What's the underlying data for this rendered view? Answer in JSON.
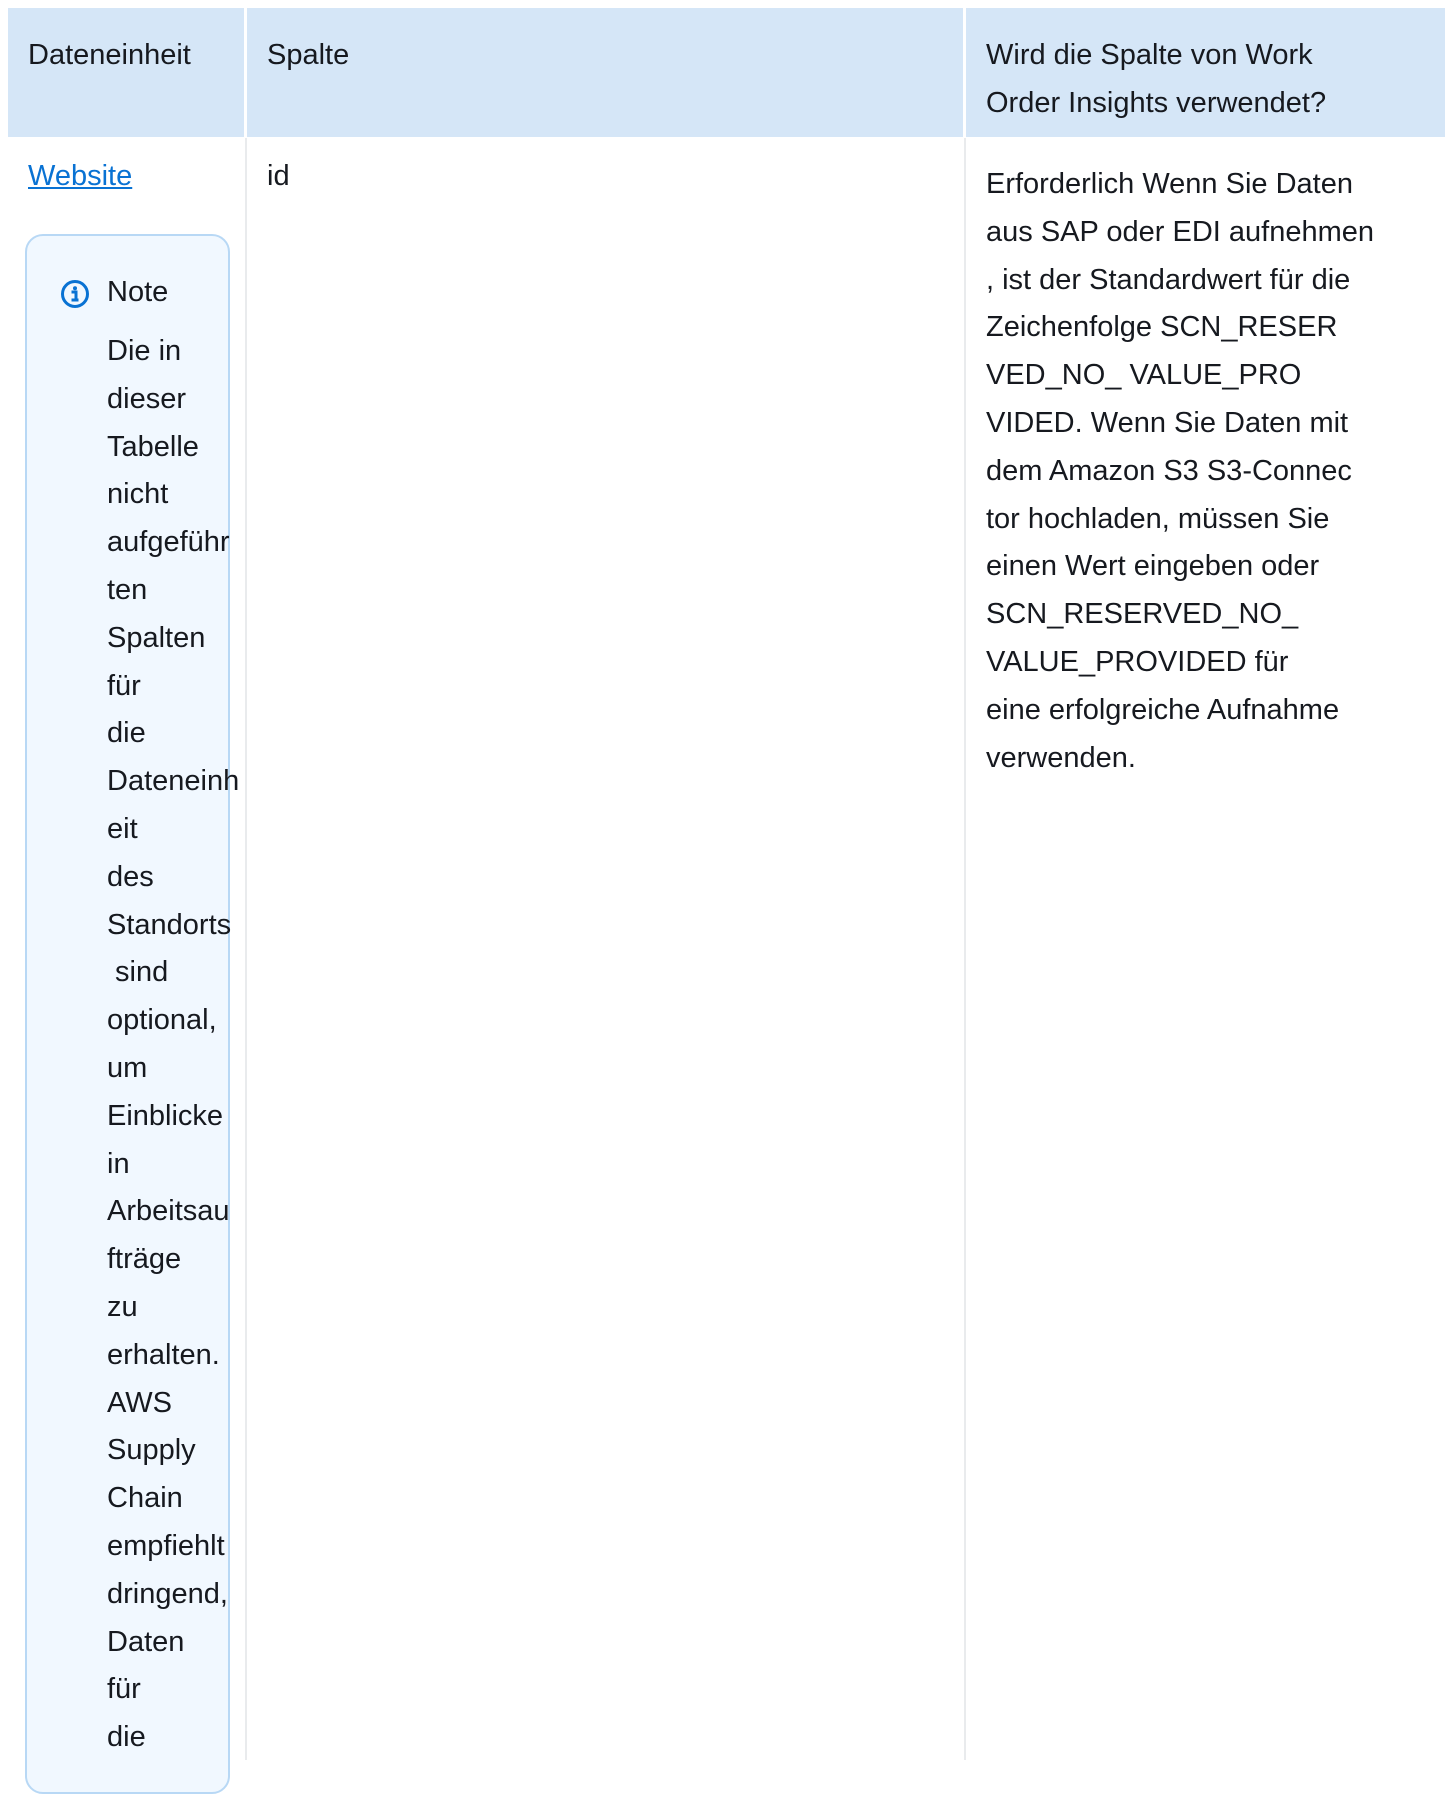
{
  "table": {
    "headers": {
      "entity": "Dateneinheit",
      "column": "Spalte",
      "used": "Wird die Spalte von Work\nOrder Insights verwendet?"
    },
    "row": {
      "entity_link": "Website",
      "note": {
        "title": "Note",
        "icon": "info-icon",
        "lines": [
          "Die in",
          "dieser",
          "Tabelle",
          "nicht",
          "aufgeführ",
          "ten",
          "Spalten",
          "für",
          "die",
          "Dateneinh",
          "eit",
          "des",
          "Standorts",
          " sind",
          "optional,",
          "um",
          "Einblicke",
          "in",
          "Arbeitsau",
          "fträge",
          "zu",
          "erhalten.",
          "AWS",
          "Supply",
          "Chain",
          "empfiehlt",
          "dringend,",
          "Daten",
          "für",
          "die"
        ]
      },
      "column_value": "id",
      "description_lines": [
        "Erforderlich Wenn Sie Daten",
        "aus SAP oder EDI aufnehmen",
        ", ist der Standardwert für die",
        "Zeichenfolge SCN_RESER",
        "VED_NO_ VALUE_PRO",
        "VIDED. Wenn Sie Daten mit",
        "dem Amazon S3 S3-Connec",
        "tor hochladen, müssen Sie",
        "einen Wert eingeben oder",
        "SCN_RESERVED_NO_",
        "VALUE_PROVIDED für",
        "eine erfolgreiche Aufnahme",
        "verwenden."
      ]
    }
  },
  "colors": {
    "header_bg": "#d5e6f7",
    "note_bg": "#f1f8ff",
    "note_border": "#b8d8f5",
    "link": "#0972d3",
    "icon": "#0972d3"
  }
}
